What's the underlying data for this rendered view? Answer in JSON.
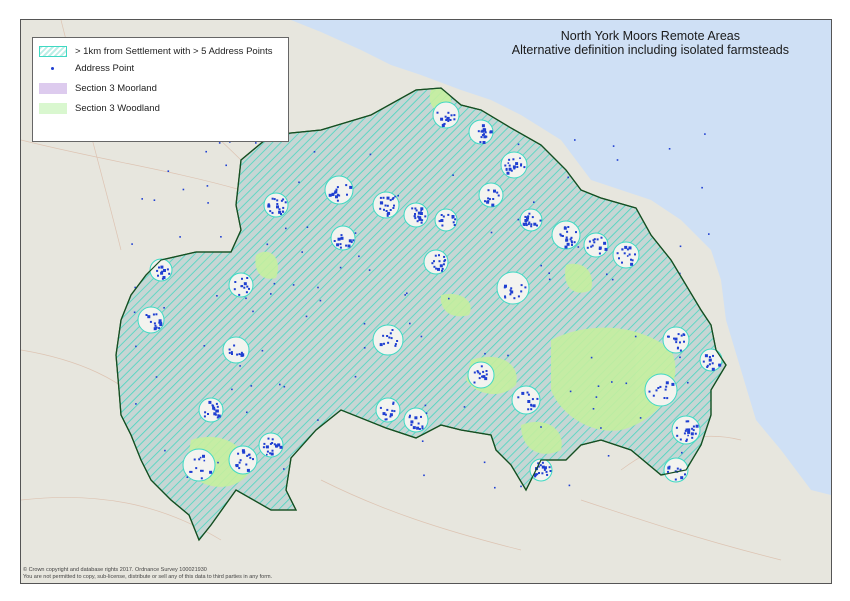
{
  "map": {
    "title_line1": "North York Moors Remote Areas",
    "title_line2": "Alternative definition including isolated farmsteads",
    "colors": {
      "sea": "#cfe0f5",
      "land": "#e6e6df",
      "remote_hatch": "#3fd9c3",
      "remote_fill": "#c9d8d6",
      "address_point": "#1f3fd1",
      "moorland": "#ddcbee",
      "woodland": "#c6f0a6",
      "boundary": "#1d6b2e"
    }
  },
  "legend": {
    "items": [
      {
        "label": "> 1km from Settlement with > 5 Address Points",
        "symbol": "remote-hatch"
      },
      {
        "label": "Address Point",
        "symbol": "dot"
      },
      {
        "label": "Section 3 Moorland",
        "symbol": "moorland-fill"
      },
      {
        "label": "Section 3 Woodland",
        "symbol": "woodland-fill"
      }
    ]
  },
  "copyright": {
    "line1": "© Crown copyright and database rights 2017. Ordnance Survey 100021930",
    "line2": "You are not permitted to copy, sub-license, distribute or sell any of this data to third parties in any form."
  }
}
